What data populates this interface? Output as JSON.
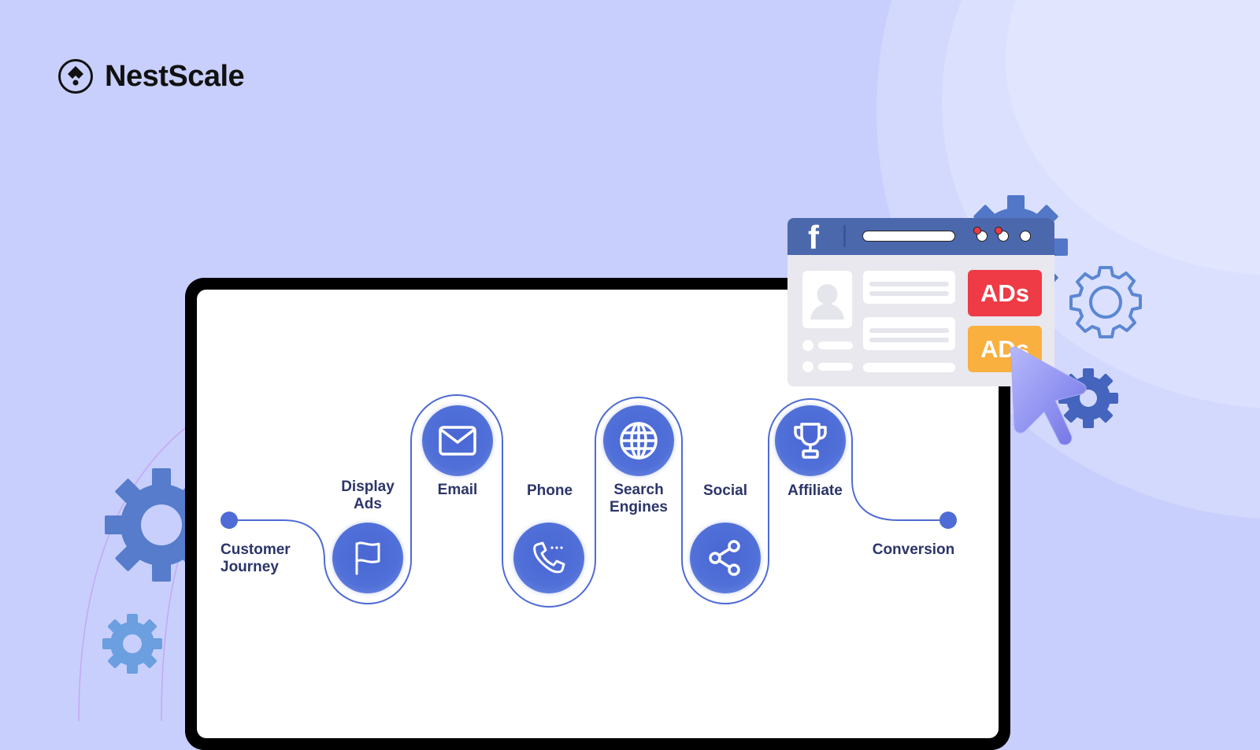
{
  "brand": {
    "name": "NestScale",
    "icon": "nestscale-logo-icon"
  },
  "journey": {
    "start_label": "Customer Journey",
    "end_label": "Conversion",
    "steps": [
      {
        "label": "Display Ads",
        "icon": "flag-icon"
      },
      {
        "label": "Email",
        "icon": "envelope-icon"
      },
      {
        "label": "Phone",
        "icon": "phone-icon"
      },
      {
        "label": "Search Engines",
        "icon": "globe-icon"
      },
      {
        "label": "Social",
        "icon": "share-icon"
      },
      {
        "label": "Affiliate",
        "icon": "trophy-icon"
      }
    ]
  },
  "facebook_window": {
    "logo": "f",
    "ads": [
      {
        "label": "ADs",
        "color": "#ef3b45"
      },
      {
        "label": "ADs",
        "color": "#f9b03f"
      }
    ]
  },
  "colors": {
    "background": "#c8cffd",
    "accent": "#4e6bd6",
    "label_text": "#2c3569",
    "facebook_blue": "#4b68ad"
  }
}
